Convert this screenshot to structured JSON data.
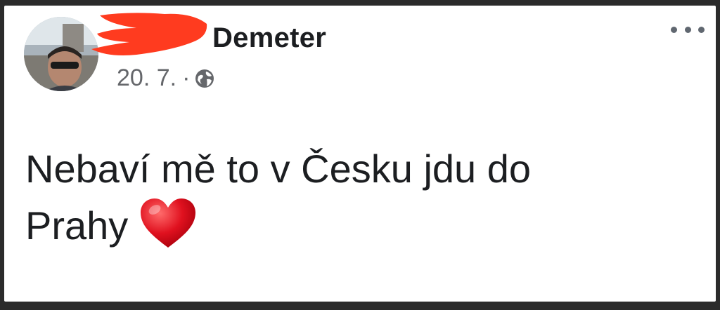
{
  "post": {
    "author": {
      "name_visible": "Demeter",
      "avatar_icon": "profile-photo"
    },
    "meta": {
      "date": "20. 7.",
      "separator": "·",
      "privacy_icon": "globe-icon"
    },
    "body": {
      "line1": "Nebaví mě to v Česku jdu do",
      "line2": "Prahy",
      "emoji": "heart-icon"
    },
    "menu_icon": "more-dots-icon"
  },
  "colors": {
    "name": "#1c1e21",
    "meta": "#65676b",
    "redaction": "#ff3b1f",
    "heart": "#e0111f"
  }
}
